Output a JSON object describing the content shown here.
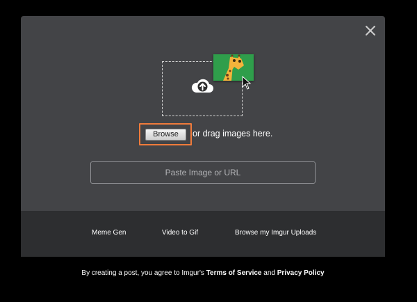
{
  "modal": {
    "close_icon": "close-icon",
    "upload_icon": "cloud-upload-icon",
    "thumbnail_icon": "giraffe-image-icon",
    "cursor_icon": "mouse-pointer-icon",
    "browse_label": "Browse",
    "drag_text": "or drag images here.",
    "url_placeholder": "Paste Image or URL",
    "highlight_color": "#f07b3b",
    "background_color": "#434447",
    "thumbnail_color": "#2f9e4b"
  },
  "footer": {
    "links": [
      "Meme Gen",
      "Video to Gif",
      "Browse my Imgur Uploads"
    ],
    "background_color": "#2d2e30"
  },
  "terms": {
    "prefix": "By creating a post, you agree to Imgur's ",
    "terms_link": "Terms of Service",
    "conjunction": " and ",
    "privacy_link": "Privacy Policy"
  }
}
